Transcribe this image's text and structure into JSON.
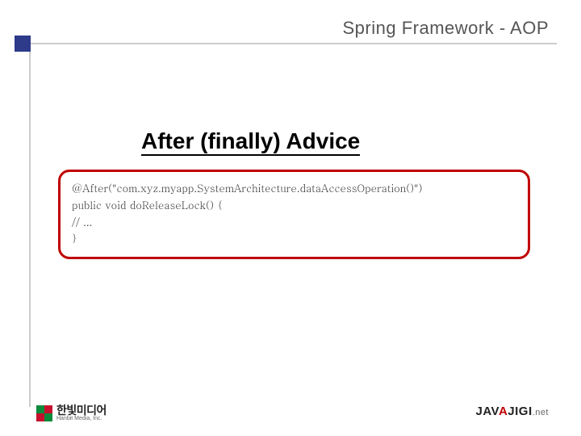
{
  "header": {
    "title": "Spring Framework - AOP"
  },
  "main": {
    "title": "After (finally) Advice"
  },
  "code": {
    "line1": "@After(\"com.xyz.myapp.SystemArchitecture.dataAccessOperation()\")",
    "line2": "public void doReleaseLock() {",
    "line3": "// ...",
    "line4": "}"
  },
  "footer": {
    "hanbit_ko": "한빛미디어",
    "hanbit_en": "Hanbit Media, Inc.",
    "javajigi_jav": "JAV",
    "javajigi_a": "A",
    "javajigi_jigi": "JIGI",
    "javajigi_net": ".net"
  }
}
